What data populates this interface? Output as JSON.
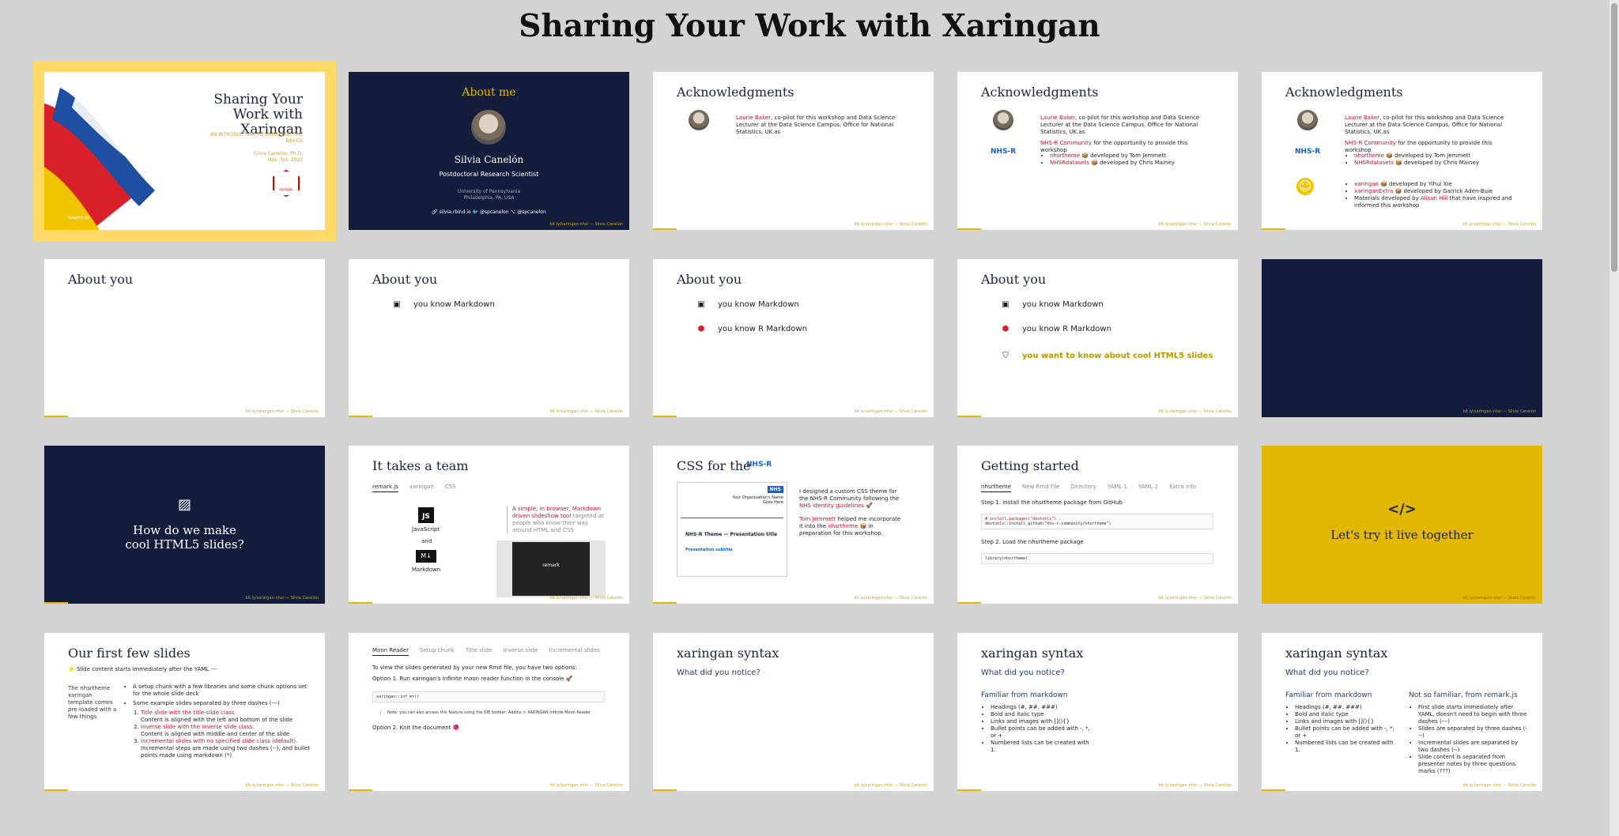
{
  "page_title": "Sharing Your Work with Xaringan",
  "footer": "bit.ly/xaringan-nhsr — Silvia Canelón",
  "s1": {
    "title": "Sharing Your Work with Xaringan",
    "subtitle": "AN INTRODUCTION TO XARINGAN: THE BASICS",
    "author": "Silvia Canelón, Ph.D.",
    "date": "Nov. 3rd, 2020",
    "credit": "Graphic by",
    "logo": "xaringan"
  },
  "s2": {
    "heading": "About me",
    "name": "Silvia Canelón",
    "role": "Postdoctoral Research Scientist",
    "inst1": "University of Pennsylvania",
    "inst2": "Philadelphia, PA, USA",
    "links": "🔗 silvia.rbind.io 🐦 @spcanelon ⌥ @spcanelon"
  },
  "ack": {
    "heading": "Acknowledgments",
    "p1a": "Laurie Baker",
    "p1b": ", co-pilot for this workshop and Data Science Lecturer at the Data Science Campus, Office for National Statistics, UK.as",
    "nhsr": "NHS-R Community",
    "nhsr_rest": " for the opportunity to provide this workshop",
    "b1": "nhsrtheme",
    "b1r": " 📦 developed by Tom Jemmett",
    "b2": "NHSRdatasets",
    "b2r": " 📦 developed by Chris Mainey",
    "c1": "xaringan",
    "c1r": " 📦 developed by Yihui Xie",
    "c2": "xaringanExtra",
    "c2r": " 📦 developed by Garrick Aden-Buie",
    "c3a": "Materials developed by ",
    "c3b": "Alison Hill",
    "c3c": " that have inspired and informed this workshop",
    "nhs_logo": "NHS-R",
    "smiley": "☺"
  },
  "about": {
    "heading": "About you",
    "r1": "you know Markdown",
    "r2": "you know R Markdown",
    "r3": "you want to know about cool HTML5 slides"
  },
  "s11": {
    "line1": "How do we make",
    "line2": "cool HTML5 slides?"
  },
  "s12": {
    "heading": "It takes a team",
    "tabs": [
      "remark.js",
      "xaringan",
      "CSS"
    ],
    "js": "JavaScript",
    "and": "and",
    "md": "Markdown",
    "quote_a": "A simple, in-browser, Markdown driven slideshow tool",
    "quote_b": " targeted at people who know their way around HTML and CSS",
    "preview": "remark"
  },
  "s13": {
    "heading": "CSS for the",
    "logo": "NHS-R",
    "text_a": "I designed a custom CSS theme for the NHS-R Community following the ",
    "link1": "NHS identity guidelines",
    "rocket": " 🚀",
    "link2": "Tom Jemmett",
    "text_b": " helped me incorporate it into the ",
    "link3": "nhsrtheme",
    "text_c": " 📦 in preparation for this workshop.",
    "mock_title": "NHS-R Theme — Presentation title",
    "mock_sub": "Presentation subtitle",
    "mock_org": "Your Organisation's Name Goes Here"
  },
  "s14": {
    "heading": "Getting started",
    "tabs": [
      "nhsrtheme",
      "New Rmd File",
      "Directory",
      "YAML 1",
      "YAML 2",
      "Extra info"
    ],
    "step1": "Step 1. Install the nhsrtheme package from GitHub",
    "code1a": "# install.packages(\"devtools\")",
    "code1b": "devtools::install_github(\"nhs-r-community/nhsrtheme\")",
    "step2": "Step 2. Load the nhsrtheme package",
    "code2": "library(nhsrtheme)"
  },
  "s15": {
    "icon": "</>",
    "text": "Let's try it live together"
  },
  "s16": {
    "heading": "Our first few slides",
    "intro": "⭐ Slide content starts immediately after the YAML ---",
    "left": "The nhsrtheme xaringan template comes pre-loaded with a few things",
    "b1": "A setup chunk with a few libraries and some chunk options set for the whole slide deck",
    "b2": "Some example slides separated by three dashes (---)",
    "o1": "Title slide with the title-slide class.",
    "o1b": "Content is aligned with the left and bottom of the slide",
    "o2": "Inverse slide with the inverse slide class.",
    "o2b": "Content is aligned with middle and center of the slide",
    "o3": "Incremental slides with no specified slide class (default).",
    "o3b": "Incremental steps are made using two dashes (--), and bullet points made using markdown (*)"
  },
  "s17": {
    "tabs": [
      "Moon Reader",
      "Setup chunk",
      "Title slide",
      "Inverse slide",
      "Incremental slides"
    ],
    "intro": "To view the slides generated by your new Rmd file, you have two options:",
    "opt1": "Option 1. Run xaringan's infinite moon reader function in the console 🚀",
    "code": "xaringan::inf_mr()",
    "note": "Note: you can also access this feature using the IDE toolbar: Addins > XARINGAN Infinite Moon Reader",
    "opt2": "Option 2. Knit the document 🧶"
  },
  "syntax": {
    "heading": "xaringan syntax",
    "q": "What did you notice?",
    "fam": "Familiar from markdown",
    "notfam": "Not so familiar, from remark.js",
    "m1": "Headings (#, ##, ###)",
    "m2": "Bold and italic type",
    "m3": "Links and images with [](){}",
    "m4": "Bullet points can be added with -, *, or +",
    "m5": "Numbered lists can be created with 1.",
    "r1": "First slide starts immediately after YAML, doesn't need to begin with three dashes (---)",
    "r2": "Slides are separated by three dashes (---)",
    "r3": "Incremental slides are separated by two dashes (--)",
    "r4": "Slide content is separated from presenter notes by three questions marks (???)"
  }
}
